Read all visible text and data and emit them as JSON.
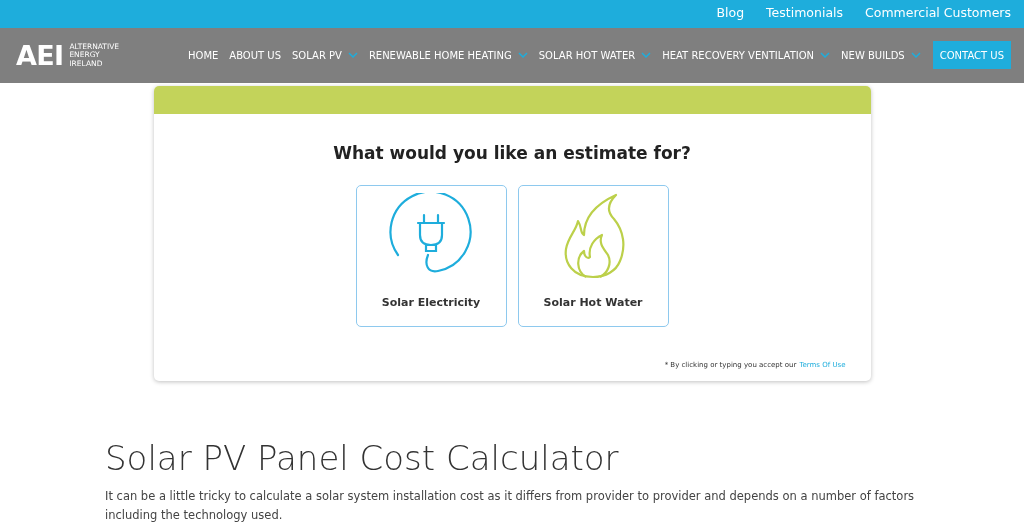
{
  "top_links": [
    "Blog",
    "Testimonials",
    "Commercial Customers"
  ],
  "logo": {
    "mark": "AEI",
    "lines": [
      "ALTERNATIVE",
      "ENERGY",
      "IRELAND"
    ]
  },
  "nav": [
    {
      "label": "HOME",
      "dropdown": false
    },
    {
      "label": "ABOUT US",
      "dropdown": false
    },
    {
      "label": "SOLAR PV",
      "dropdown": true
    },
    {
      "label": "RENEWABLE HOME HEATING",
      "dropdown": true
    },
    {
      "label": "SOLAR HOT WATER",
      "dropdown": true
    },
    {
      "label": "HEAT RECOVERY VENTILATION",
      "dropdown": true
    },
    {
      "label": "NEW BUILDS",
      "dropdown": true
    }
  ],
  "contact_button": "CONTACT US",
  "estimate": {
    "question": "What would you like an estimate for?",
    "options": [
      {
        "kind": "plug",
        "label": "Solar Electricity"
      },
      {
        "kind": "flame",
        "label": "Solar Hot Water"
      }
    ],
    "terms_text": "* By clicking or typing you accept our",
    "terms_link": "Terms Of Use"
  },
  "article": {
    "title": "Solar PV Panel Cost Calculator",
    "body": "It can be a little tricky to calculate a solar system installation cost as it differs from provider to provider and depends on a number of factors including the technology used."
  }
}
